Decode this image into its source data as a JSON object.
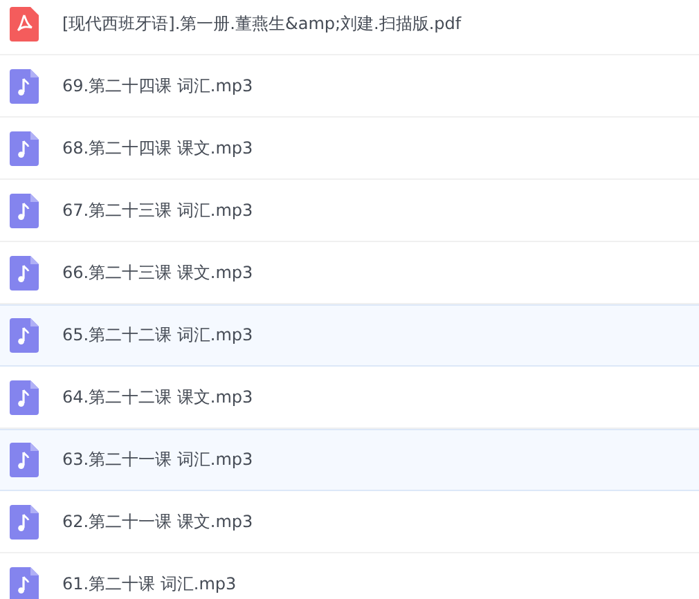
{
  "files": [
    {
      "name": "[现代西班牙语].第一册.董燕生&amp;刘建.扫描版.pdf",
      "kind": "pdf",
      "selected": false
    },
    {
      "name": "69.第二十四课 词汇.mp3",
      "kind": "audio",
      "selected": false
    },
    {
      "name": "68.第二十四课 课文.mp3",
      "kind": "audio",
      "selected": false
    },
    {
      "name": "67.第二十三课 词汇.mp3",
      "kind": "audio",
      "selected": false
    },
    {
      "name": "66.第二十三课 课文.mp3",
      "kind": "audio",
      "selected": false
    },
    {
      "name": "65.第二十二课 词汇.mp3",
      "kind": "audio",
      "selected": true
    },
    {
      "name": "64.第二十二课 课文.mp3",
      "kind": "audio",
      "selected": false
    },
    {
      "name": "63.第二十一课 词汇.mp3",
      "kind": "audio",
      "selected": true
    },
    {
      "name": "62.第二十一课 课文.mp3",
      "kind": "audio",
      "selected": false
    },
    {
      "name": "61.第二十课 词汇.mp3",
      "kind": "audio",
      "selected": false
    }
  ]
}
